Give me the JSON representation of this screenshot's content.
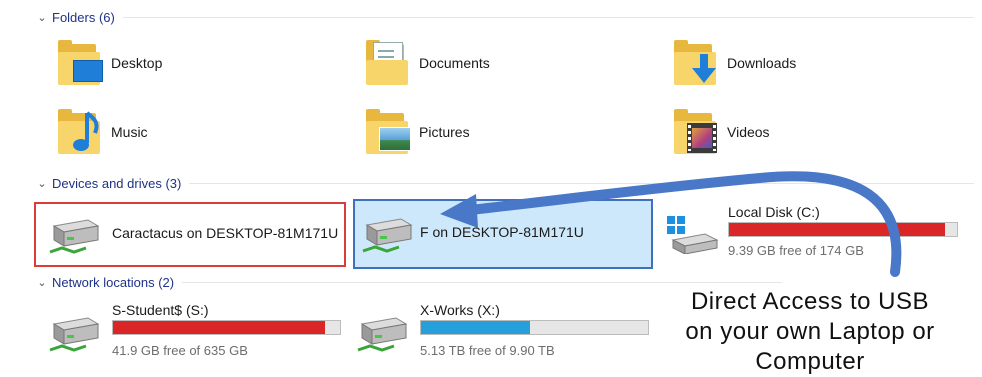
{
  "groups": {
    "folders": "Folders (6)",
    "devices": "Devices and drives (3)",
    "network": "Network locations (2)"
  },
  "folders": [
    {
      "label": "Desktop",
      "icon": "desktop-folder-icon"
    },
    {
      "label": "Documents",
      "icon": "documents-folder-icon"
    },
    {
      "label": "Downloads",
      "icon": "downloads-folder-icon"
    },
    {
      "label": "Music",
      "icon": "music-folder-icon"
    },
    {
      "label": "Pictures",
      "icon": "pictures-folder-icon"
    },
    {
      "label": "Videos",
      "icon": "videos-folder-icon"
    }
  ],
  "devices": [
    {
      "label": "Caractacus on DESKTOP-81M171U",
      "icon": "network-drive-icon"
    },
    {
      "label": "F on DESKTOP-81M171U",
      "icon": "network-drive-icon"
    },
    {
      "label": "Local Disk (C:)",
      "free": "9.39 GB free of 174 GB",
      "used_fraction": 0.946,
      "bar_color": "#da2626",
      "icon": "windows-drive-icon"
    }
  ],
  "network": [
    {
      "label": "S-Student$ (S:)",
      "free": "41.9 GB free of 635 GB",
      "used_fraction": 0.934,
      "bar_color": "#da2626",
      "icon": "network-drive-icon"
    },
    {
      "label": "X-Works (X:)",
      "free": "5.13 TB free of 9.90 TB",
      "used_fraction": 0.482,
      "bar_color": "#26a0da",
      "icon": "network-drive-icon"
    }
  ],
  "annotation": {
    "line1": "Direct Access to USB",
    "line2": "on your own Laptop or",
    "line3": "Computer",
    "arrow_color": "#4a78c8",
    "highlight_color": "#da3b3b"
  }
}
